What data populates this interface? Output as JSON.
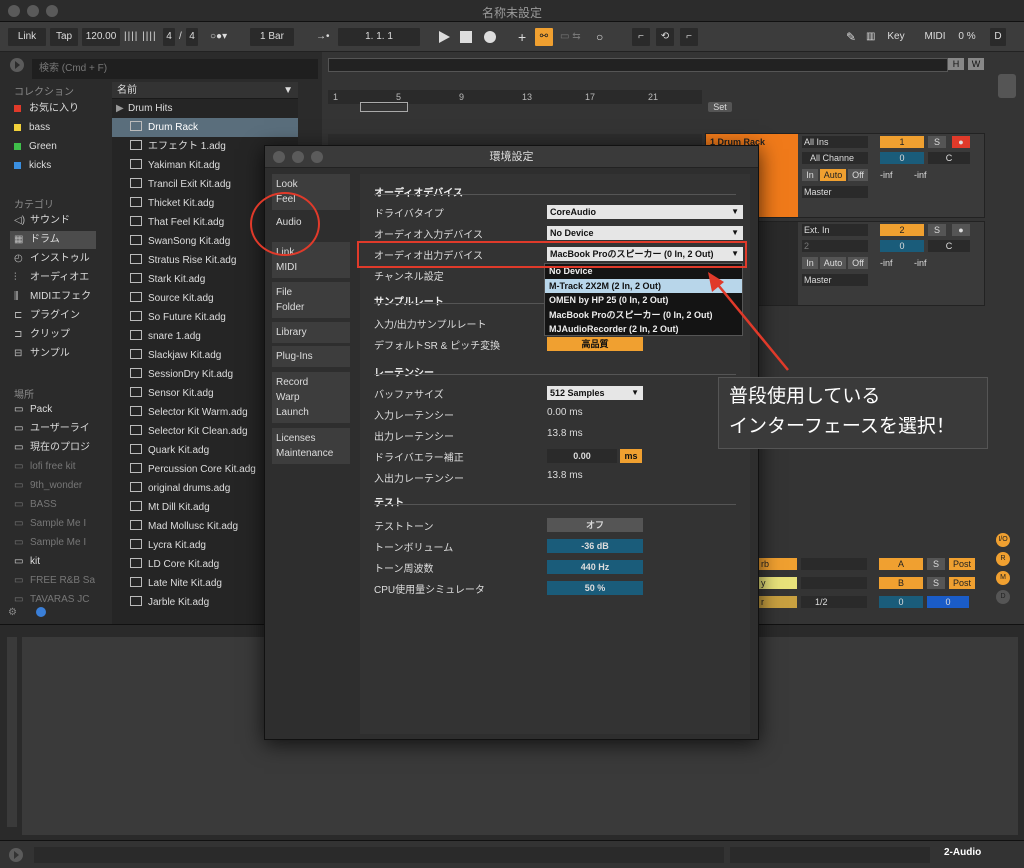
{
  "window": {
    "title": "名称未設定"
  },
  "transport": {
    "link": "Link",
    "tap": "Tap",
    "tempo": "120.00",
    "signature_num": "4",
    "signature_den": "4",
    "quantize": "1 Bar",
    "position": "1.  1.  1",
    "key": "Key",
    "midi": "MIDI",
    "cpu": "0 %",
    "d": "D"
  },
  "browser": {
    "search_placeholder": "検索 (Cmd + F)",
    "collections_header": "コレクション",
    "collections": [
      {
        "label": "お気に入り",
        "color": "#e03a2a"
      },
      {
        "label": "bass",
        "color": "#f2d13a"
      },
      {
        "label": "Green",
        "color": "#3fbf4a"
      },
      {
        "label": "kicks",
        "color": "#3a8fe0"
      }
    ],
    "categories_header": "カテゴリ",
    "categories": [
      "サウンド",
      "ドラム",
      "インストゥル",
      "オーディオエ",
      "MIDIエフェク",
      "プラグイン",
      "クリップ",
      "サンプル"
    ],
    "places_header": "場所",
    "places": [
      "Pack",
      "ユーザーライ",
      "現在のプロジ",
      "lofi free kit",
      "9th_wonder",
      "BASS",
      "Sample Me I",
      "Sample Me I",
      "kit",
      "FREE R&B Sa",
      "TAVARAS JC"
    ],
    "list_header": "名前",
    "items": [
      "Drum Hits",
      "Drum Rack",
      "エフェクト 1.adg",
      "Yakiman Kit.adg",
      "Trancil Exit Kit.adg",
      "Thicket Kit.adg",
      "That Feel Kit.adg",
      "SwanSong Kit.adg",
      "Stratus Rise Kit.adg",
      "Stark Kit.adg",
      "Source Kit.adg",
      "So Future Kit.adg",
      "snare 1.adg",
      "Slackjaw Kit.adg",
      "SessionDry Kit.adg",
      "Sensor Kit.adg",
      "Selector Kit Warm.adg",
      "Selector Kit Clean.adg",
      "Quark Kit.adg",
      "Percussion Core Kit.adg",
      "original drums.adg",
      "Mt Dill Kit.adg",
      "Mad Mollusc Kit.adg",
      "Lycra Kit.adg",
      "LD Core Kit.adg",
      "Late Nite Kit.adg",
      "Jarble Kit.adg"
    ]
  },
  "arrangement": {
    "ruler": [
      "1",
      "5",
      "9",
      "13",
      "17",
      "21"
    ],
    "h": "H",
    "w": "W",
    "set": "Set"
  },
  "tracks": [
    {
      "name": "1 Drum Rack",
      "input": "All Ins",
      "channel": "All Channe",
      "monitor_in": "In",
      "monitor_auto": "Auto",
      "monitor_off": "Off",
      "output": "Master",
      "num": "1",
      "s": "S",
      "vol": "0",
      "pan": "C",
      "db1": "-inf",
      "db2": "-inf"
    },
    {
      "name": "2 Audio",
      "input": "Ext. In",
      "channel": "2",
      "monitor_in": "In",
      "monitor_auto": "Auto",
      "monitor_off": "Off",
      "output": "Master",
      "num": "2",
      "s": "S",
      "vol": "0",
      "pan": "C",
      "db1": "-inf",
      "db2": "-inf"
    }
  ],
  "returns": [
    {
      "name": "rb",
      "letter": "A",
      "s": "S",
      "post": "Post"
    },
    {
      "name": "y",
      "letter": "B",
      "s": "S",
      "post": "Post"
    },
    {
      "name": "r",
      "send": "1/2",
      "vol": "0",
      "vol2": "0"
    }
  ],
  "side_buttons": [
    "I/O",
    "R",
    "M",
    "D"
  ],
  "dialog": {
    "title": "環境設定",
    "tabs": [
      [
        "Look",
        "Feel"
      ],
      [
        "Audio"
      ],
      [
        "Link",
        "MIDI"
      ],
      [
        "File",
        "Folder"
      ],
      [
        "Library"
      ],
      [
        "Plug-Ins"
      ],
      [
        "Record",
        "Warp",
        "Launch"
      ],
      [
        "Licenses",
        "Maintenance"
      ]
    ],
    "sections": {
      "audio_device": "オーディオデバイス",
      "sample_rate": "サンプルレート",
      "latency": "レーテンシー",
      "test": "テスト"
    },
    "driver_type_label": "ドライバタイプ",
    "driver_type_value": "CoreAudio",
    "input_device_label": "オーディオ入力デバイス",
    "input_device_value": "No Device",
    "output_device_label": "オーディオ出力デバイス",
    "output_device_value": "MacBook Proのスピーカー (0 In, 2 Out)",
    "channel_config_label": "チャンネル設定",
    "io_samplerate_label": "入力/出力サンプルレート",
    "default_sr_label": "デフォルトSR & ピッチ変換",
    "default_sr_value": "高品質",
    "buffer_size_label": "バッファサイズ",
    "buffer_size_value": "512 Samples",
    "input_latency_label": "入力レーテンシー",
    "input_latency_value": "0.00 ms",
    "output_latency_label": "出力レーテンシー",
    "output_latency_value": "13.8 ms",
    "driver_error_label": "ドライバエラー補正",
    "driver_error_value": "0.00",
    "driver_error_unit": "ms",
    "overall_latency_label": "入出力レーテンシー",
    "overall_latency_value": "13.8 ms",
    "test_tone_label": "テストトーン",
    "test_tone_value": "オフ",
    "tone_volume_label": "トーンボリューム",
    "tone_volume_value": "-36 dB",
    "tone_freq_label": "トーン周波数",
    "tone_freq_value": "440 Hz",
    "cpu_sim_label": "CPU使用量シミュレータ",
    "cpu_sim_value": "50 %"
  },
  "popup": {
    "options": [
      "No Device",
      "M-Track 2X2M (2 In, 2 Out)",
      "OMEN by HP 25 (0 In, 2 Out)",
      "MacBook Proのスピーカー (0 In, 2 Out)",
      "MJAudioRecorder (2 In, 2 Out)"
    ],
    "selected": 1
  },
  "callout": {
    "line1": "普段使用している",
    "line2": "インターフェースを選択！"
  },
  "status": {
    "track": "2-Audio"
  }
}
